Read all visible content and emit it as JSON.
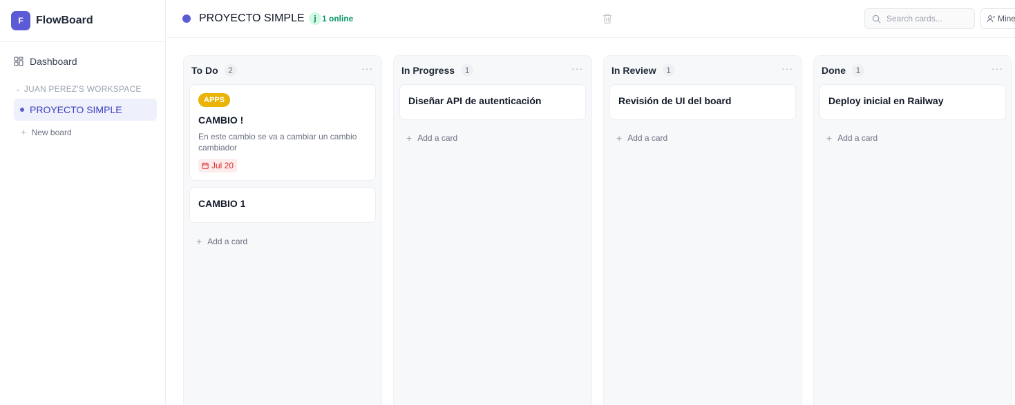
{
  "app": {
    "brand_initial": "F",
    "brand_name": "FlowBoard"
  },
  "sidebar": {
    "dashboard_label": "Dashboard",
    "workspace_label": "JUAN PEREZ'S WORKSPACE",
    "boards": [
      {
        "label": "PROYECTO SIMPLE",
        "active": true
      }
    ],
    "new_board_label": "New board"
  },
  "header": {
    "board_title": "PROYECTO SIMPLE",
    "online_avatar": "j",
    "online_text": "1 online",
    "search_placeholder": "Search cards...",
    "mine_label": "Mine"
  },
  "colors": {
    "accent": "#5b5bd6",
    "tag_apps": "#eab308",
    "due_red": "#dc2626",
    "online_green": "#059669"
  },
  "columns": [
    {
      "title": "To Do",
      "count": "2",
      "more": "···",
      "cards": [
        {
          "tag": "APPS",
          "title": "CAMBIO !",
          "description": "En este cambio se va a cambiar un cambio cambiador",
          "due": "Jul 20"
        },
        {
          "title": "CAMBIO 1"
        }
      ],
      "add_label": "Add a card"
    },
    {
      "title": "In Progress",
      "count": "1",
      "more": "···",
      "cards": [
        {
          "title": "Diseñar API de autenticación"
        }
      ],
      "add_label": "Add a card"
    },
    {
      "title": "In Review",
      "count": "1",
      "more": "···",
      "cards": [
        {
          "title": "Revisión de UI del board"
        }
      ],
      "add_label": "Add a card"
    },
    {
      "title": "Done",
      "count": "1",
      "more": "···",
      "cards": [
        {
          "title": "Deploy inicial en Railway"
        }
      ],
      "add_label": "Add a card"
    }
  ]
}
